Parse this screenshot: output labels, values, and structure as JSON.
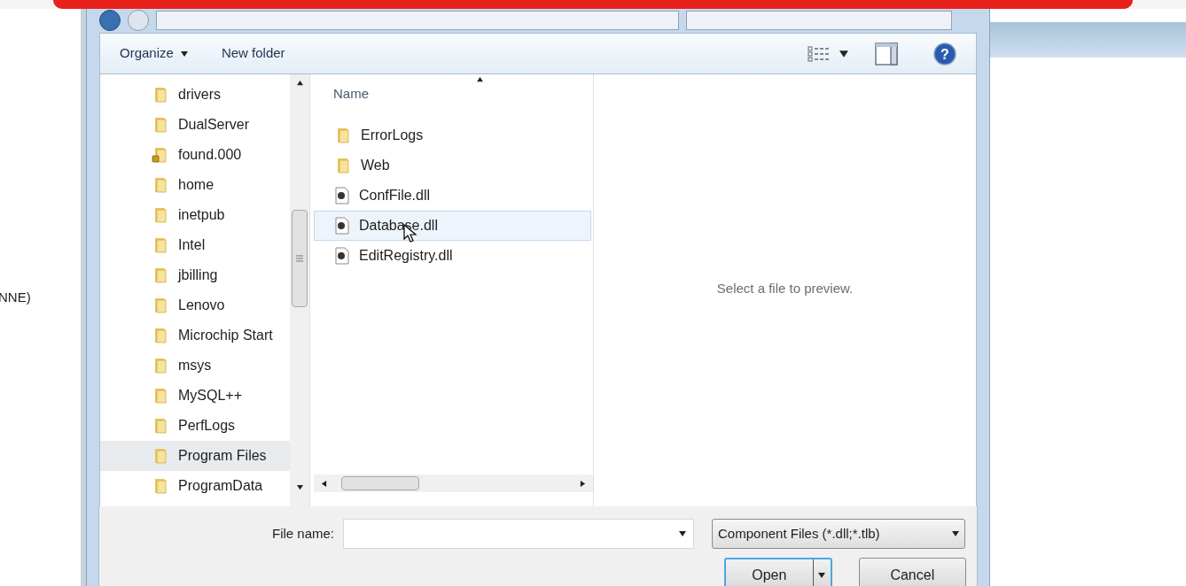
{
  "background_window": {
    "text_fragment": "NNE)"
  },
  "toolbar": {
    "organize": "Organize",
    "new_folder": "New folder",
    "help": "?"
  },
  "nav_pane": {
    "items": [
      {
        "label": "drivers",
        "kind": "folder",
        "selected": false
      },
      {
        "label": "DualServer",
        "kind": "folder",
        "selected": false
      },
      {
        "label": "found.000",
        "kind": "locked",
        "selected": false
      },
      {
        "label": "home",
        "kind": "folder",
        "selected": false
      },
      {
        "label": "inetpub",
        "kind": "folder",
        "selected": false
      },
      {
        "label": "Intel",
        "kind": "folder",
        "selected": false
      },
      {
        "label": "jbilling",
        "kind": "folder",
        "selected": false
      },
      {
        "label": "Lenovo",
        "kind": "folder",
        "selected": false
      },
      {
        "label": "Microchip Start",
        "kind": "folder",
        "selected": false
      },
      {
        "label": "msys",
        "kind": "folder",
        "selected": false
      },
      {
        "label": "MySQL++",
        "kind": "folder",
        "selected": false
      },
      {
        "label": "PerfLogs",
        "kind": "folder",
        "selected": false
      },
      {
        "label": "Program Files",
        "kind": "folder",
        "selected": true
      },
      {
        "label": "ProgramData",
        "kind": "folder",
        "selected": false
      }
    ]
  },
  "file_list": {
    "column": "Name",
    "items": [
      {
        "label": "ErrorLogs",
        "kind": "folder",
        "selected": false
      },
      {
        "label": "Web",
        "kind": "folder",
        "selected": false
      },
      {
        "label": "ConfFile.dll",
        "kind": "file",
        "selected": false
      },
      {
        "label": "Database.dll",
        "kind": "file",
        "selected": true
      },
      {
        "label": "EditRegistry.dll",
        "kind": "file",
        "selected": false
      }
    ]
  },
  "preview": {
    "message": "Select a file to preview."
  },
  "file_name": {
    "label": "File name:"
  },
  "file_type": {
    "value": "Component Files (*.dll;*.tlb)"
  },
  "buttons": {
    "open": "Open",
    "cancel": "Cancel"
  }
}
